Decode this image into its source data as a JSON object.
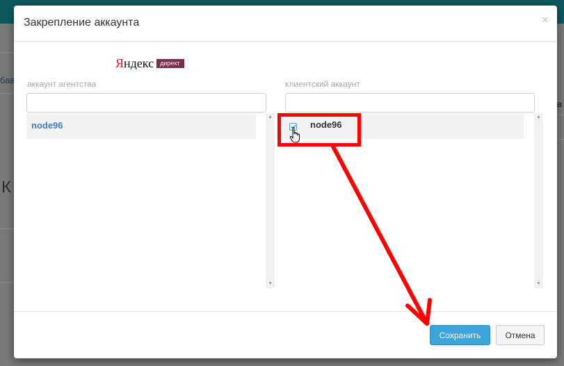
{
  "background": {
    "link_fragment": "бав",
    "heading_fragment": "К",
    "right_fragment": "в"
  },
  "modal": {
    "title": "Закрепление аккаунта",
    "close_glyph": "×",
    "logo": {
      "yandex": "Яндекс",
      "yandex_first_letter": "Я",
      "yandex_rest": "ндекс",
      "direct": "директ"
    },
    "agency": {
      "label": "аккаунт агентства",
      "search_value": "",
      "items": [
        {
          "name": "node96"
        }
      ]
    },
    "client": {
      "label": "клиентский аккаунт",
      "search_value": "",
      "items": [
        {
          "name": "node96",
          "checked": true
        }
      ]
    },
    "footer": {
      "save_label": "Сохранить",
      "cancel_label": "Отмена"
    }
  },
  "colors": {
    "primary": "#3ca4d8",
    "link": "#3a7fc1",
    "annotation": "#ff0000",
    "topbar": "#0c5a5f",
    "logo_direct": "#7a2d4a"
  },
  "icons": {
    "close": "close-icon",
    "checkbox": "checkbox-checked-icon",
    "cursor": "hand-pointer-icon",
    "scroll_up": "arrow-up-icon",
    "scroll_down": "arrow-down-icon"
  }
}
